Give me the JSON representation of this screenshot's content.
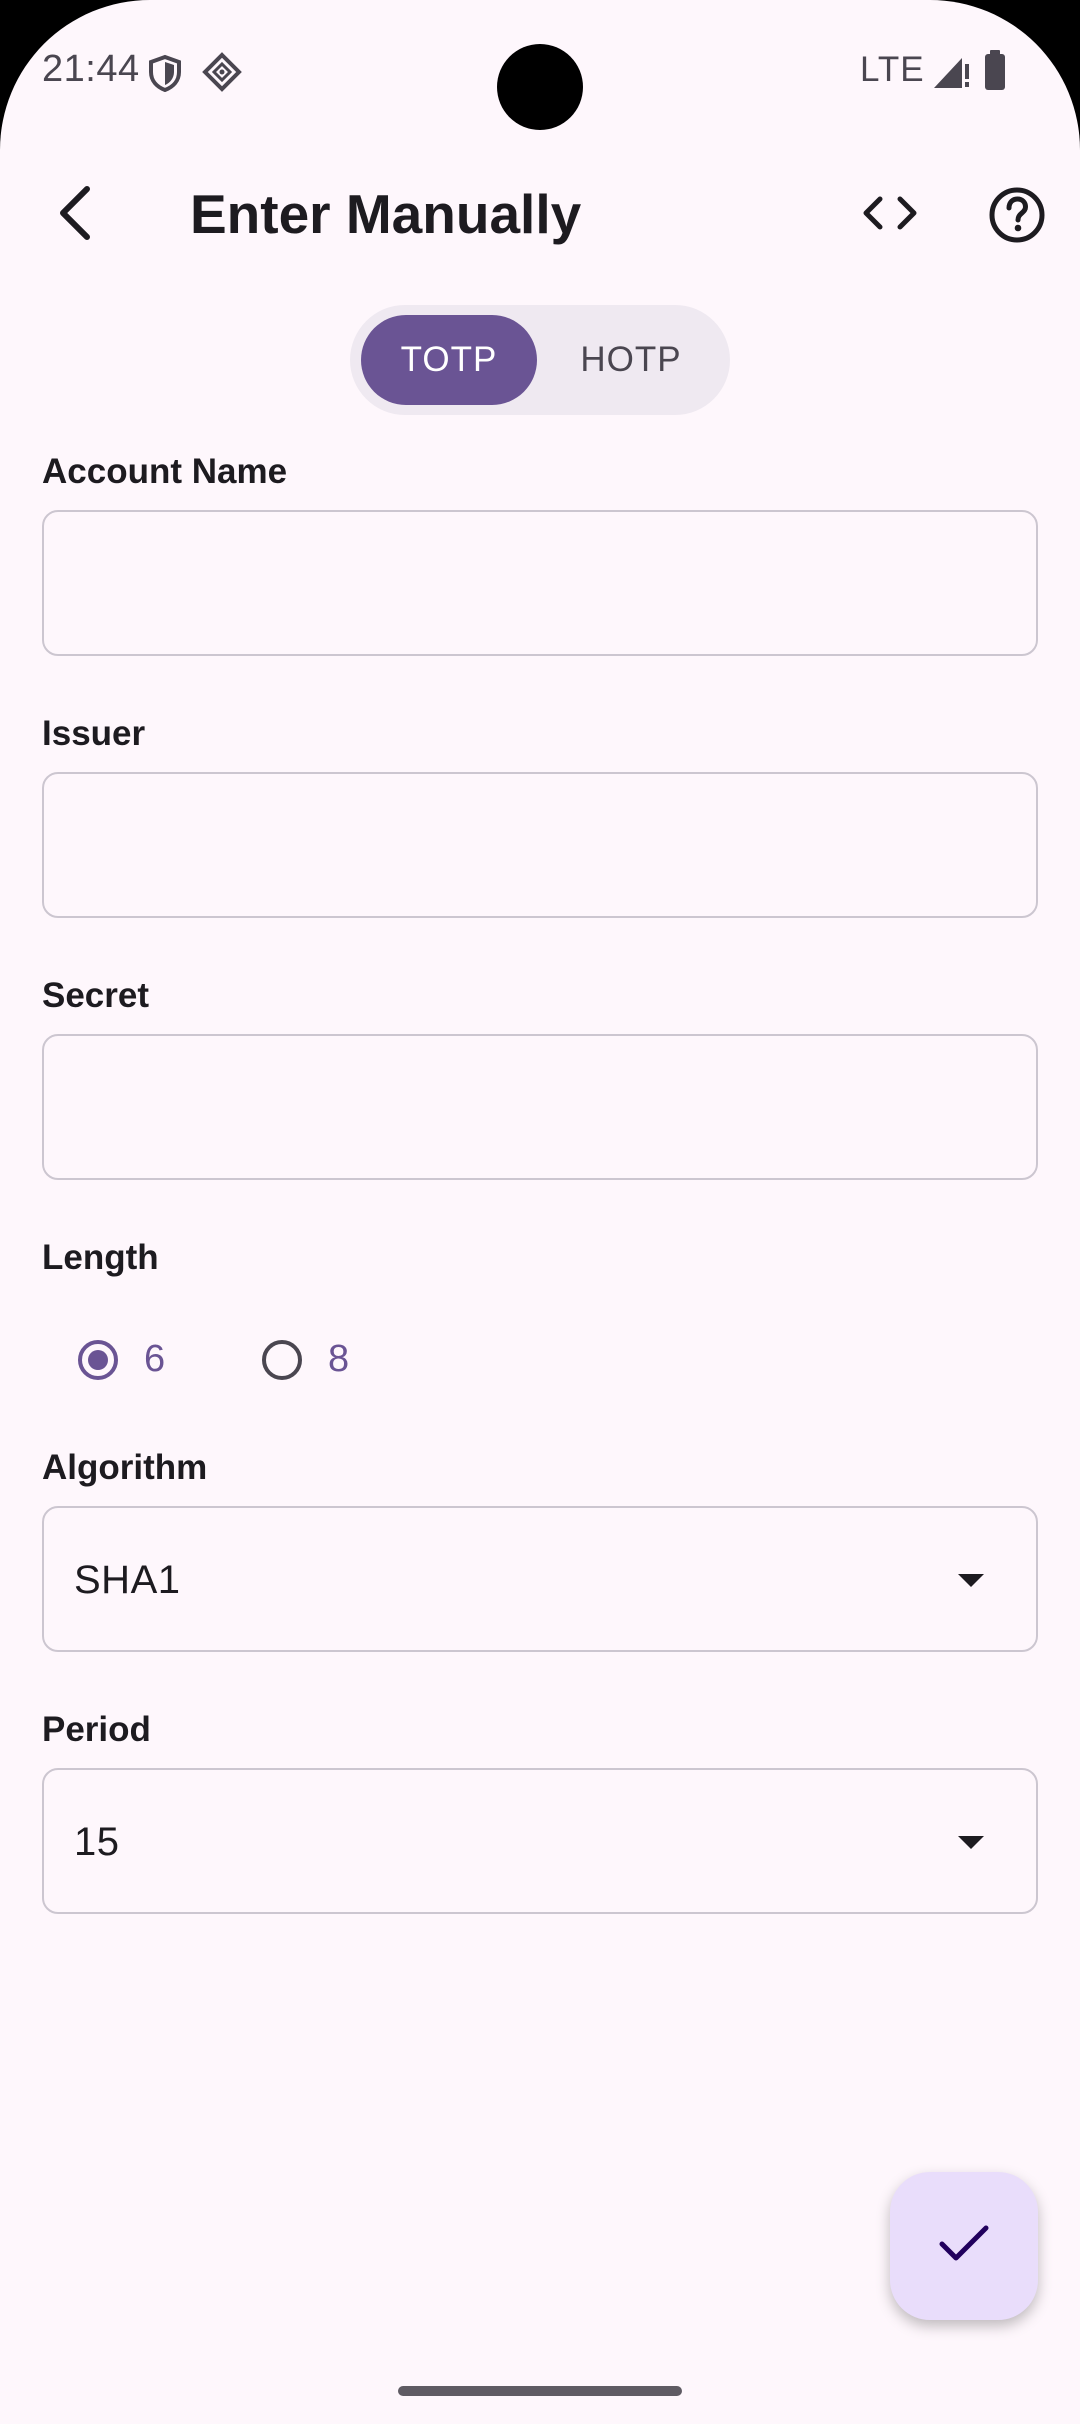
{
  "status_bar": {
    "time": "21:44",
    "network": "LTE",
    "icons": [
      "shield-icon",
      "vpn-diamond-icon",
      "signal-icon",
      "battery-icon"
    ]
  },
  "app_bar": {
    "title": "Enter Manually",
    "icons": [
      "back-arrow-icon",
      "code-icon",
      "help-icon"
    ]
  },
  "otp_type": {
    "options": [
      "TOTP",
      "HOTP"
    ],
    "selected": "TOTP"
  },
  "form": {
    "account_name": {
      "label": "Account Name",
      "value": ""
    },
    "issuer": {
      "label": "Issuer",
      "value": ""
    },
    "secret": {
      "label": "Secret",
      "value": ""
    },
    "length": {
      "label": "Length",
      "options": [
        "6",
        "8"
      ],
      "selected": "6"
    },
    "algorithm": {
      "label": "Algorithm",
      "value": "SHA1"
    },
    "period": {
      "label": "Period",
      "value": "15"
    }
  },
  "fab": {
    "icon": "check-icon"
  },
  "colors": {
    "background": "#fef7fc",
    "primary": "#6a5494",
    "fab_background": "#e9ddfb",
    "outline": "#ccc6d0",
    "text": "#1d1b20"
  }
}
